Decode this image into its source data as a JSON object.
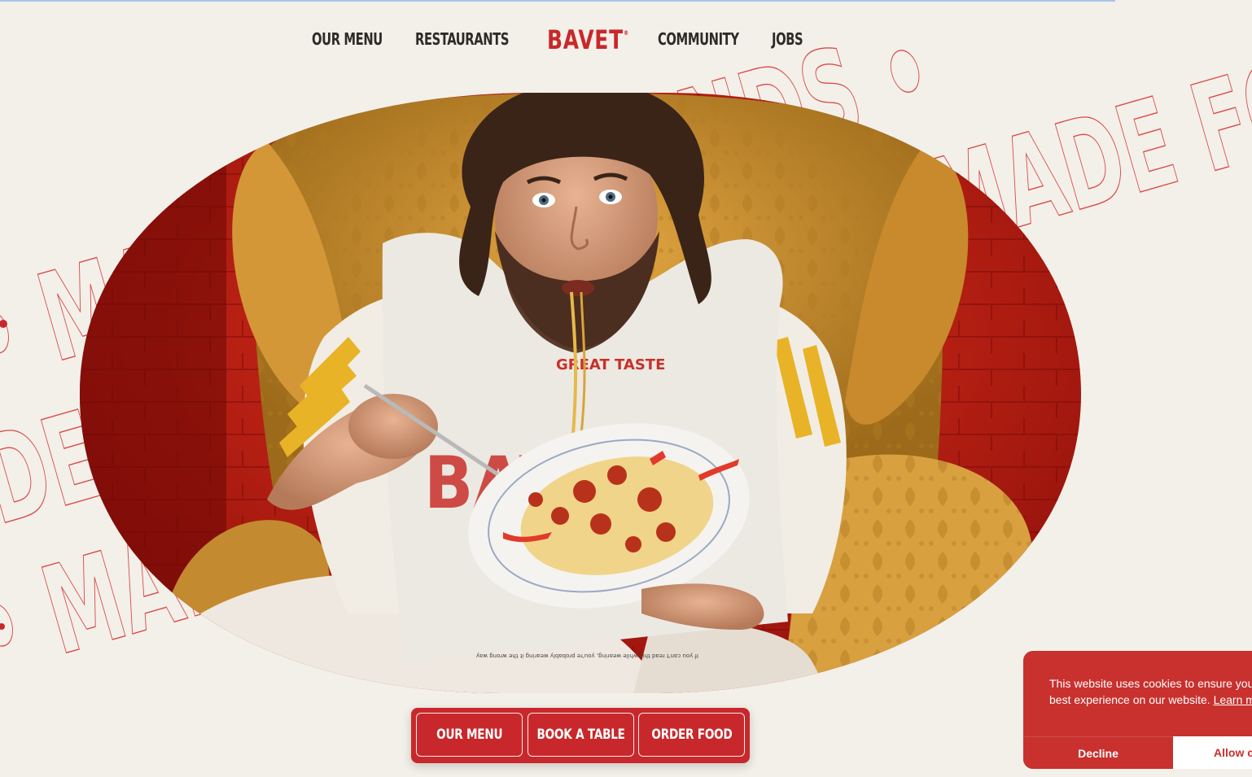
{
  "nav": {
    "items": [
      {
        "label": "OUR MENU"
      },
      {
        "label": "RESTAURANTS"
      },
      {
        "label": "COMMUNITY"
      },
      {
        "label": "JOBS"
      }
    ],
    "logo": "BAVET",
    "logo_mark": "®"
  },
  "background_text": {
    "line1": "MADE FOR FRIENDS",
    "line2": "• MADE FOR FRIENDS •",
    "line3": "MADE FOR FRIENDS",
    "line4": "• MADE"
  },
  "hero": {
    "image": "man-eating-spaghetti-photo",
    "bib_text": "GREAT TASTE",
    "bib_brand": "BAVET",
    "bib_small": "If you can't read this while wearing, you're probably wearing it the wrong way"
  },
  "cta": {
    "menu_label": "OUR MENU",
    "book_label": "BOOK A TABLE",
    "order_label": "ORDER FOOD"
  },
  "cookie": {
    "text_line1": "This website uses cookies to ensure you",
    "text_line2": "best experience on our website.",
    "learn_more": "Learn m",
    "decline_label": "Decline",
    "allow_label": "Allow co"
  },
  "colors": {
    "brand_red": "#c8282b",
    "background": "#f3f0e9",
    "nav_text": "#2d2a28"
  }
}
